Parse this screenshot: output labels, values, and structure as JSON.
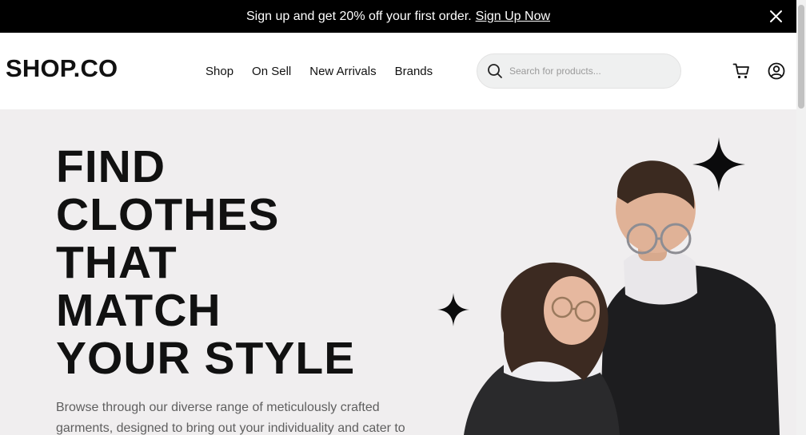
{
  "promo": {
    "text": "Sign up and get 20% off your first order.",
    "link_label": "Sign Up Now"
  },
  "header": {
    "logo": "SHOP.CO",
    "nav": [
      "Shop",
      "On Sell",
      "New Arrivals",
      "Brands"
    ],
    "search_placeholder": "Search for products...",
    "search_value": ""
  },
  "hero": {
    "headline_lines": [
      "FIND",
      "CLOTHES",
      "THAT",
      "MATCH",
      "YOUR STYLE"
    ],
    "subtext": "Browse through our diverse range of meticulously crafted garments, designed to bring out your individuality and cater to"
  },
  "colors": {
    "bar": "#000000",
    "hero_bg": "#f0eeef",
    "text_primary": "#111111",
    "text_muted": "#5f5f5f"
  },
  "icons": [
    "close-icon",
    "search-icon",
    "cart-icon",
    "user-icon",
    "sparkle-icon"
  ]
}
